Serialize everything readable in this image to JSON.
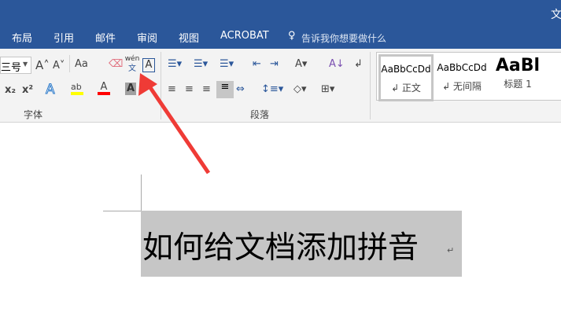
{
  "window": {
    "title_fragment": "文"
  },
  "tabs": [
    "布局",
    "引用",
    "邮件",
    "审阅",
    "视图",
    "ACROBAT"
  ],
  "tell_me": "告诉我你想要做什么",
  "font": {
    "size_value": "三号",
    "group_label": "字体",
    "change_case": "Aa",
    "phonetic_top": "wén",
    "phonetic_bottom": "文",
    "border_char": "A",
    "subscript": "x₂",
    "superscript": "x²",
    "text_effect": "A",
    "highlight": "ab",
    "font_color": "A",
    "shading": "A"
  },
  "paragraph": {
    "group_label": "段落"
  },
  "styles": [
    {
      "preview": "AaBbCcDd",
      "name": "↲ 正文"
    },
    {
      "preview": "AaBbCcDd",
      "name": "↲ 无间隔"
    },
    {
      "preview": "AaBl",
      "name": "标题 1"
    }
  ],
  "document": {
    "text": "如何给文档添加拼音",
    "para_mark": "↵"
  },
  "colors": {
    "accent": "#2b579a",
    "highlight": "#ffff00",
    "font_color": "#ff0000",
    "arrow": "#ef3b36"
  }
}
